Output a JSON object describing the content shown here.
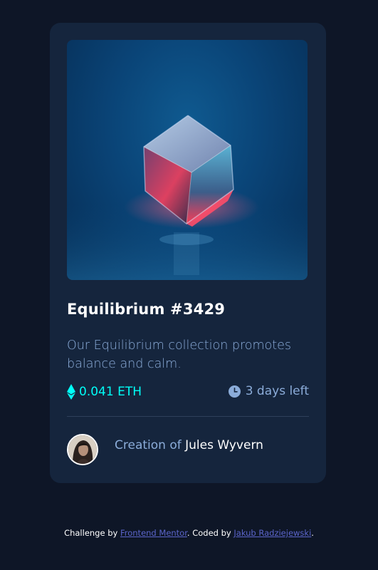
{
  "card": {
    "title": "Equilibrium #3429",
    "description": "Our Equilibrium collection promotes balance and calm.",
    "price": "0.041 ETH",
    "time_left": "3 days left",
    "creator_prefix": "Creation of",
    "creator_name": "Jules Wyvern"
  },
  "footer": {
    "challenge_prefix": "Challenge by",
    "challenge_link": "Frontend Mentor",
    "coded_prefix": ". Coded by",
    "coder_link": "Jakub Radziejewski",
    "end": "."
  },
  "icons": {
    "price": "ethereum-icon",
    "time": "clock-icon",
    "avatar": "avatar"
  },
  "colors": {
    "page_bg": "#0e1627",
    "card_bg": "#15253d",
    "soft_blue": "#8bacd9",
    "cyan": "#00fff8",
    "white": "#ffffff",
    "link": "#5a64c9",
    "divider": "#2e405a"
  }
}
